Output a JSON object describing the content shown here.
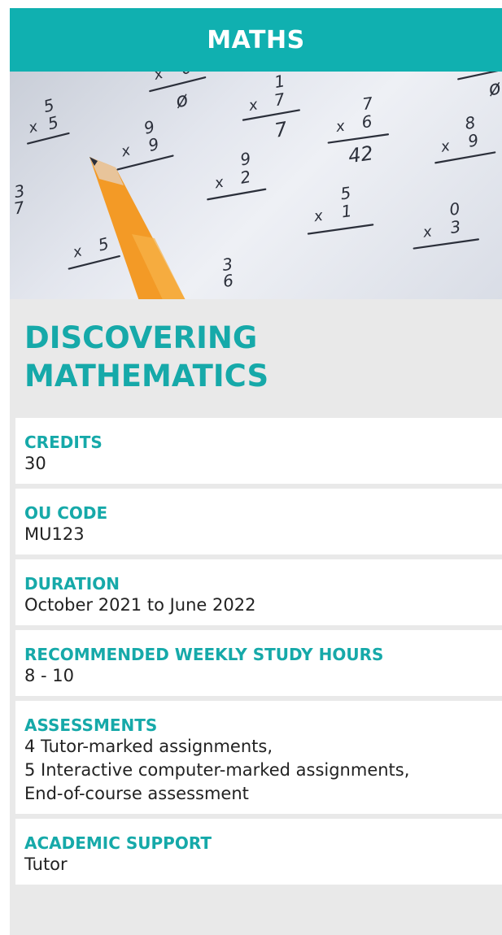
{
  "header": {
    "subject": "MATHS"
  },
  "hero": {
    "image": "maths-worksheet-with-pencil"
  },
  "course": {
    "title": "DISCOVERING MATHEMATICS"
  },
  "info": [
    {
      "label": "CREDITS",
      "value": "30"
    },
    {
      "label": "OU CODE",
      "value": "MU123"
    },
    {
      "label": "DURATION",
      "value": "October 2021 to June 2022"
    },
    {
      "label": "RECOMMENDED WEEKLY STUDY HOURS",
      "value": "8 - 10"
    },
    {
      "label": "ASSESSMENTS",
      "value": "4 Tutor-marked assignments,\n5 Interactive computer-marked assignments,\nEnd-of-course assessment"
    },
    {
      "label": "ACADEMIC SUPPORT",
      "value": "Tutor"
    }
  ],
  "colors": {
    "accent": "#10b0b0",
    "panel": "#e9e9e9",
    "text": "#222222"
  }
}
